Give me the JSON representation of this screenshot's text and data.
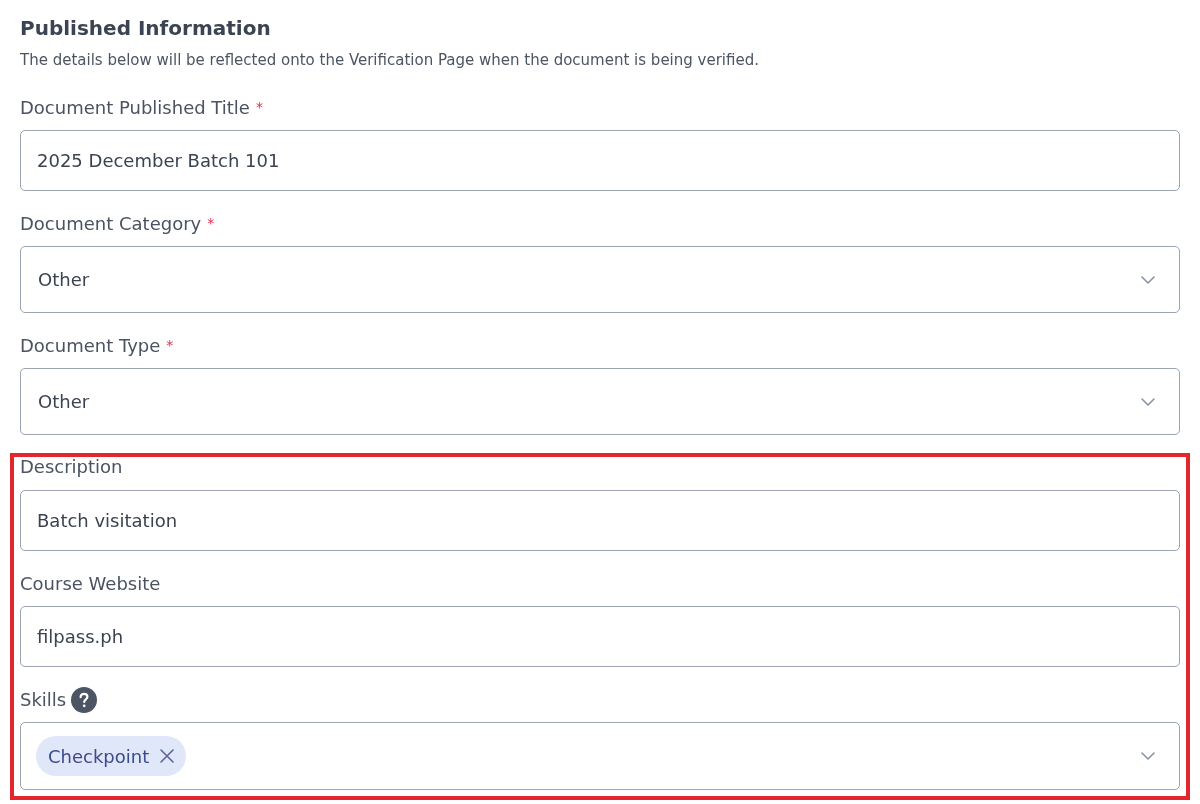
{
  "section": {
    "title": "Published Information",
    "subtitle": "The details below will be reflected onto the Verification Page when the document is being verified."
  },
  "fields": [
    {
      "kind": "text",
      "label": "Document Published Title",
      "required_mark": "*",
      "help_icon": false,
      "value": "2025 December Batch 101"
    },
    {
      "kind": "select",
      "label": "Document Category",
      "required_mark": "*",
      "help_icon": false,
      "value": "Other"
    },
    {
      "kind": "select",
      "label": "Document Type",
      "required_mark": "*",
      "help_icon": false,
      "value": "Other"
    }
  ],
  "highlighted_group": {
    "outlined": true,
    "fields": [
      {
        "kind": "text",
        "label": "Description",
        "help_icon": false,
        "value": "Batch visitation"
      },
      {
        "kind": "text",
        "label": "Course Website",
        "help_icon": false,
        "value": "filpass.ph"
      },
      {
        "kind": "tags",
        "label": "Skills",
        "help_icon": true,
        "tags": [
          "Checkpoint"
        ]
      }
    ]
  }
}
